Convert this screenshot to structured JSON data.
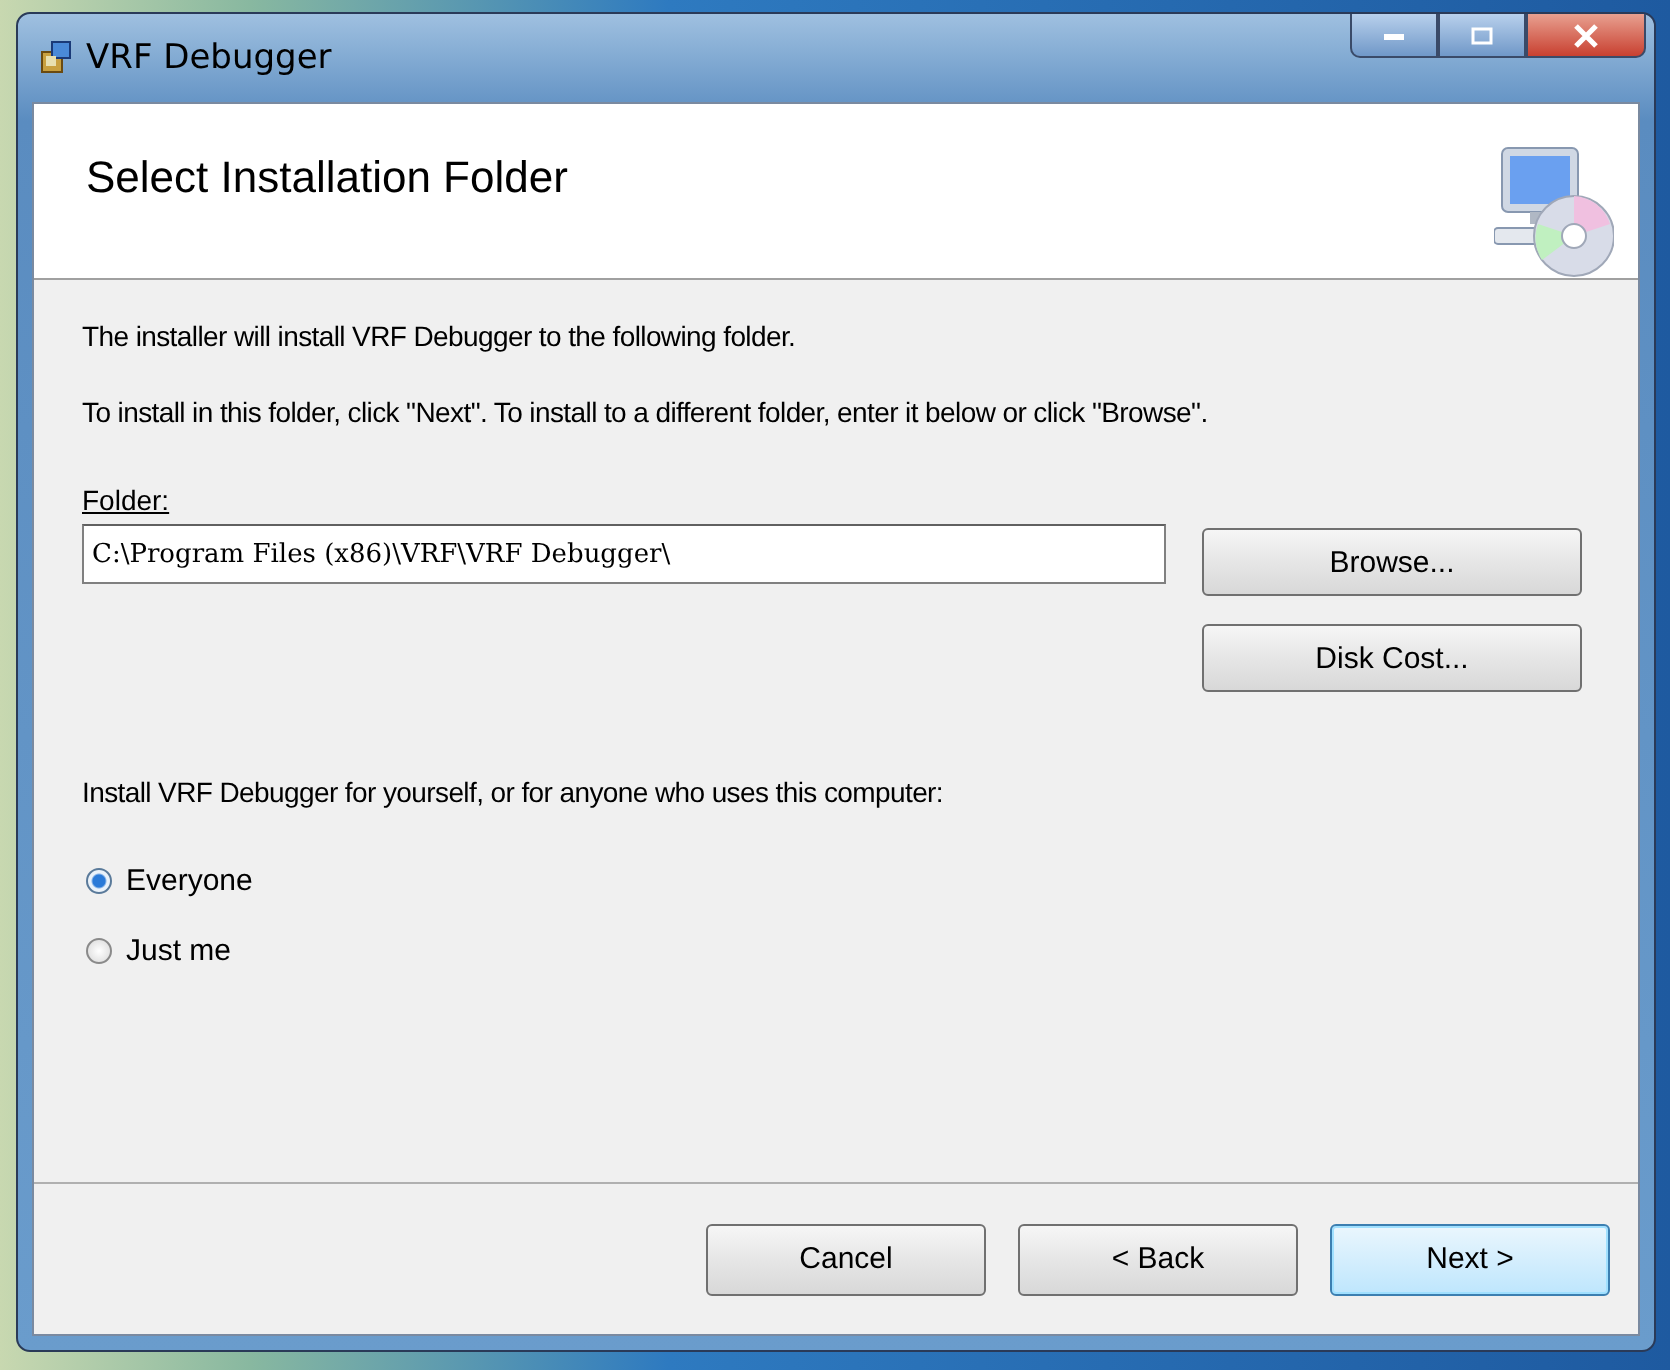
{
  "window": {
    "title": "VRF Debugger"
  },
  "header": {
    "title": "Select Installation Folder"
  },
  "intro": [
    "The installer will install VRF Debugger to the following folder.",
    "To install in this folder, click \"Next\". To install to a different folder, enter it below or click \"Browse\"."
  ],
  "folder": {
    "label": "Folder:",
    "value": "C:\\Program Files (x86)\\VRF\\VRF Debugger\\"
  },
  "side_buttons": [
    "Browse...",
    "Disk Cost..."
  ],
  "scope": {
    "prompt": "Install VRF Debugger for yourself, or for anyone who uses this computer:",
    "options": [
      {
        "label": "Everyone",
        "selected": true
      },
      {
        "label": "Just me",
        "selected": false
      }
    ]
  },
  "buttons": [
    {
      "label": "Cancel",
      "default": false
    },
    {
      "label": "< Back",
      "default": false
    },
    {
      "label": "Next >",
      "default": true
    }
  ]
}
